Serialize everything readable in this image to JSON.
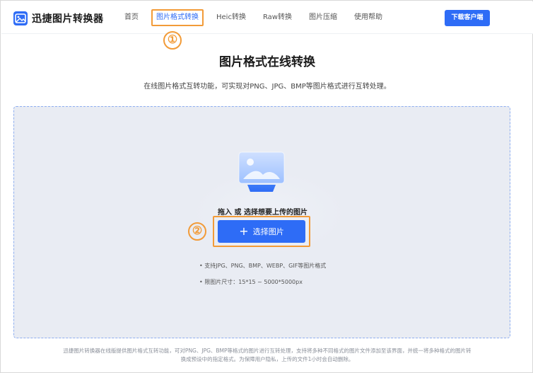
{
  "header": {
    "logo_text": "迅捷图片转换器",
    "nav": [
      "首页",
      "图片格式转换",
      "Heic转换",
      "Raw转换",
      "图片压缩",
      "使用帮助"
    ],
    "download_label": "下载客户端"
  },
  "markers": {
    "one": "①",
    "two": "②"
  },
  "main": {
    "title": "图片格式在线转换",
    "subtitle": "在线图片格式互转功能，可实现对PNG、JPG、BMP等图片格式进行互转处理。",
    "drop_hint": "拖入 或 选择想要上传的图片",
    "select_label": "选择图片",
    "info": [
      "• 支持JPG、PNG、BMP、WEBP、GIF等图片格式",
      "• 限图片尺寸：15*15 ~ 5000*5000px"
    ]
  },
  "footer": {
    "line1": "迅捷图片转换器在线版提供图片格式互转功能，可对PNG、JPG、BMP等格式的图片进行互转处理，支持将多种不同格式的图片文件添加至该界面，并统一将多种格式的图片转",
    "line2": "换成预设中的指定格式。为保障用户隐私，上传的文件1小时会自动删除。"
  },
  "colors": {
    "accent": "#2e6cf6",
    "highlight": "#f29b38"
  }
}
